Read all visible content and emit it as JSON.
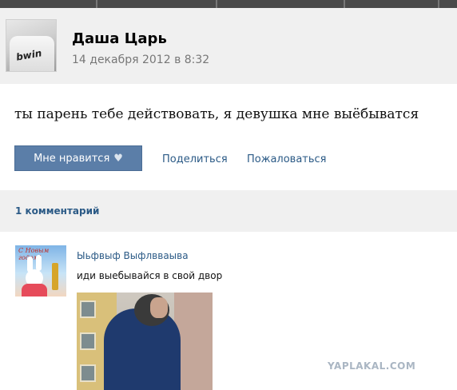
{
  "post": {
    "author": "Даша Царь",
    "date": "14 декабря 2012 в 8:32",
    "avatar_text": "bwin",
    "text": "ты парень тебе действовать, я девушка мне выёбыватся"
  },
  "actions": {
    "like_label": "Мне нравится",
    "like_icon": "heart-icon",
    "share_label": "Поделиться",
    "report_label": "Пожаловаться"
  },
  "comments": {
    "count_label": "1 комментарий",
    "items": [
      {
        "author": "Ыьфвыф Выфлвваыва",
        "text": "иди выебывайся в свой двор",
        "avatar_text": "С Новым годом!"
      }
    ]
  },
  "watermark": "YAPLAKAL.COM",
  "colors": {
    "link": "#2b5a86",
    "button_bg": "#5b7ea8",
    "section_bg": "#f0f0f0"
  }
}
